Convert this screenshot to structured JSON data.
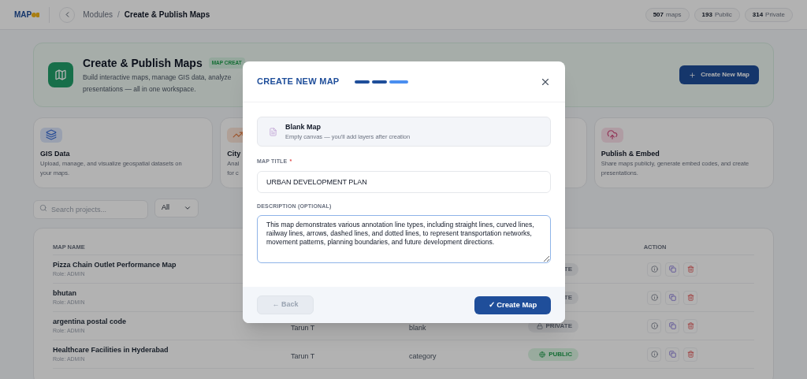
{
  "header": {
    "logo": "MAP",
    "breadcrumb": [
      {
        "label": "Modules",
        "current": false
      },
      {
        "label": "Create & Publish Maps",
        "current": true
      }
    ],
    "separator": "/",
    "stats": [
      {
        "number": "507",
        "label": "maps"
      },
      {
        "number": "193",
        "label": "Public"
      },
      {
        "number": "314",
        "label": "Private"
      }
    ]
  },
  "hero": {
    "title": "Create & Publish Maps",
    "badge": "MAP CREAT",
    "lines": [
      "Build interactive maps, manage GIS data, analyze",
      "presentations — all in one workspace."
    ],
    "button": "Create New Map"
  },
  "features": [
    {
      "kind": "data",
      "title": "GIS Data",
      "lines": [
        "Upload, manage, and visualize geospatial datasets on",
        "your maps."
      ]
    },
    {
      "kind": "analytics",
      "title": "City",
      "lines": [
        "Anal",
        "for c"
      ]
    },
    {
      "kind": "hidden"
    },
    {
      "kind": "publish",
      "title": "Publish & Embed",
      "lines": [
        "Share maps publicly, generate embed codes, and create",
        "presentations."
      ]
    }
  ],
  "filters": {
    "search": {
      "placeholder": "Search projects..."
    },
    "select": "All"
  },
  "table": {
    "columns": [
      "MAP NAME",
      "ACTION"
    ],
    "rows": [
      {
        "name": "Pizza Chain Outlet Performance Map",
        "role": "Role: ADMIN",
        "visibility": {
          "kind": "private",
          "label": "TE"
        }
      },
      {
        "name": "bhutan",
        "role": "Role: ADMIN",
        "visibility": {
          "kind": "private",
          "label": "TE"
        }
      },
      {
        "name": "argentina postal code",
        "role": "Role: ADMIN",
        "owner": "Tarun T",
        "type": "blank",
        "visibility": {
          "kind": "private",
          "label": "PRIVATE",
          "icon": true
        }
      },
      {
        "name": "Healthcare Facilities in Hyderabad",
        "role": "Role: ADMIN",
        "owner": "Tarun T",
        "type": "category",
        "visibility": {
          "kind": "public",
          "label": "PUBLIC",
          "icon": true
        }
      }
    ]
  },
  "modal": {
    "title": "CREATE NEW MAP",
    "steps": [
      {
        "current": false
      },
      {
        "current": false
      },
      {
        "current": true
      }
    ],
    "template": {
      "title": "Blank Map",
      "subtitle": "Empty canvas — you'll add layers after creation"
    },
    "title_field": {
      "label": "MAP TITLE",
      "required_mark": "*",
      "value": "URBAN DEVELOPMENT PLAN"
    },
    "description_field": {
      "label": "DESCRIPTION (OPTIONAL)",
      "value": "This map demonstrates various annotation line types, including straight lines, curved lines, railway lines, arrows, dashed lines, and dotted lines, to represent transportation networks, movement patterns, planning boundaries, and future development directions."
    },
    "back_button": {
      "label": "← Back",
      "disabled": true
    },
    "create_button": "✓ Create Map"
  }
}
